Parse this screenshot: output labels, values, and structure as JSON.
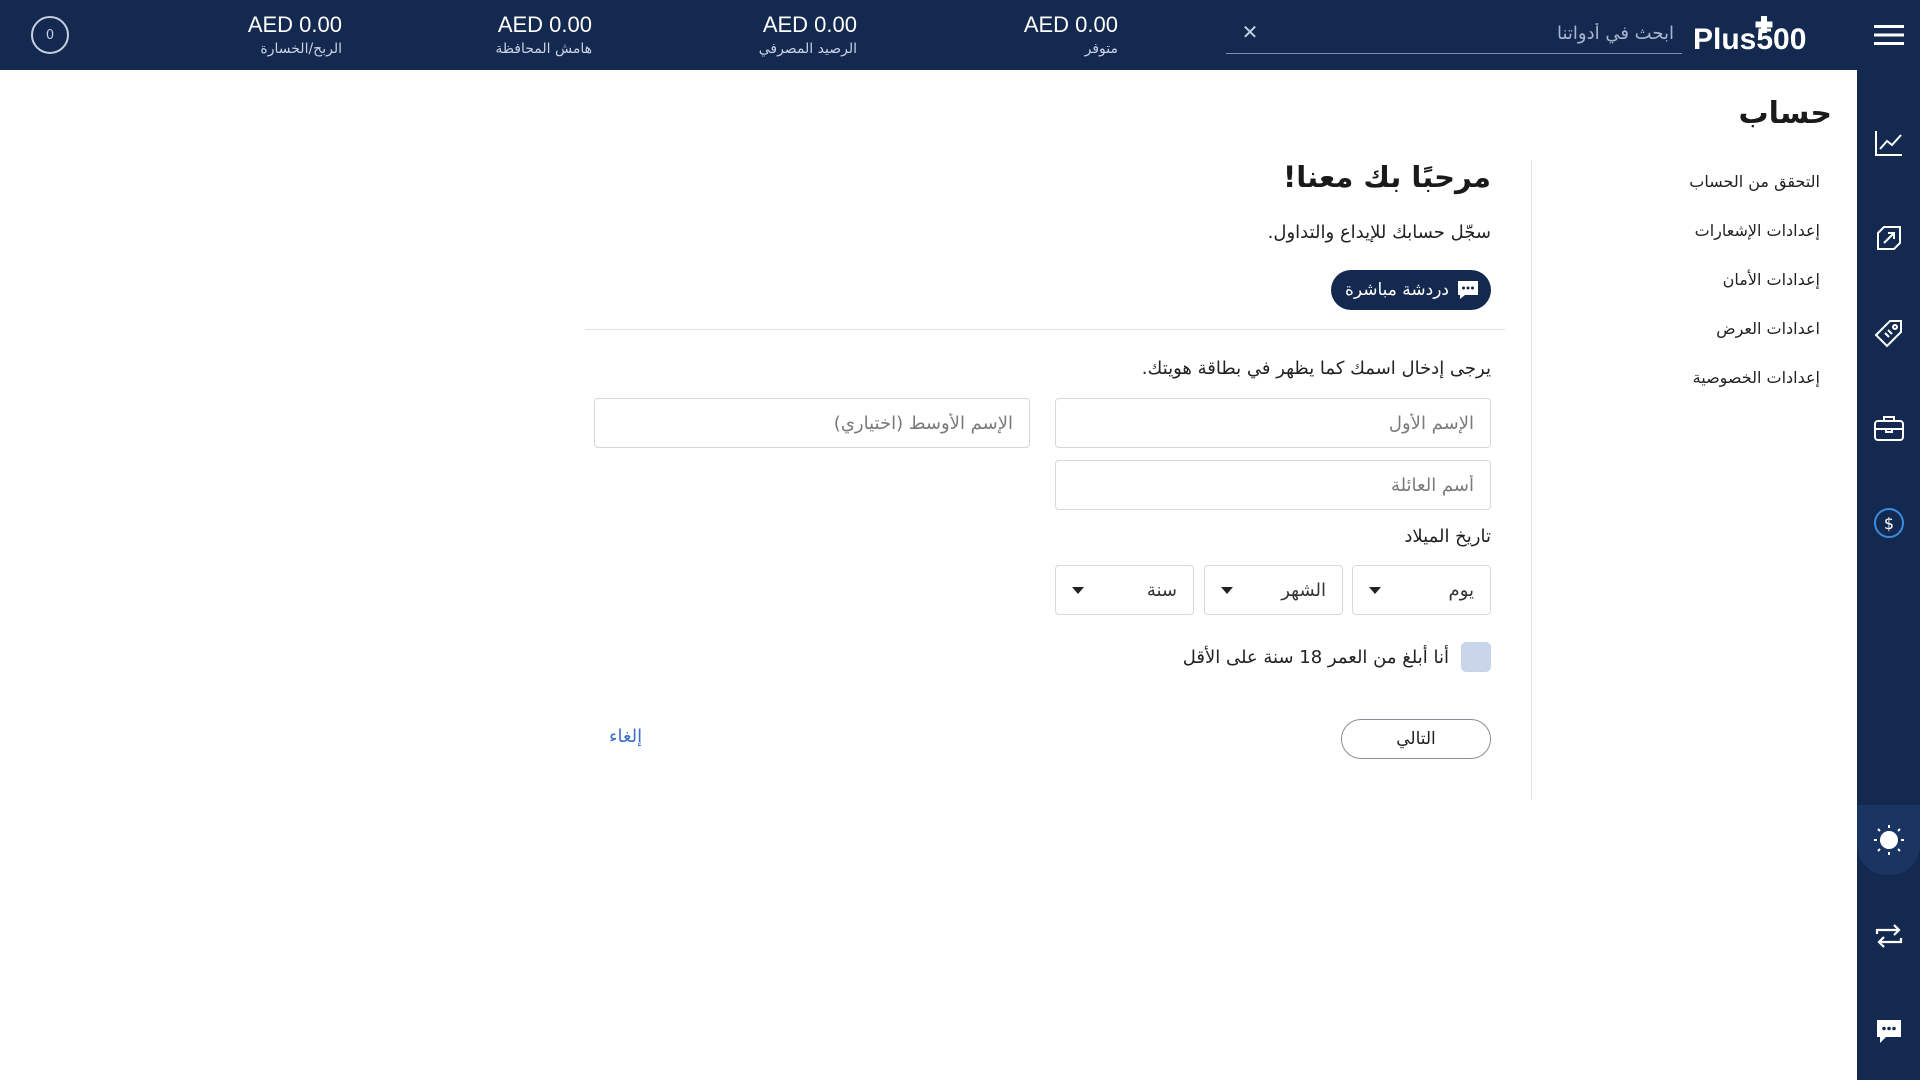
{
  "brand": {
    "name": "Plus500",
    "color": "#14294f",
    "accent": "#3b6fc6"
  },
  "search": {
    "placeholder": "ابحث في أدواتنا",
    "clear_icon": "close-icon"
  },
  "stats": [
    {
      "value": "AED 0.00",
      "label": "متوفر"
    },
    {
      "value": "AED 0.00",
      "label": "الرصيد المصرفي"
    },
    {
      "value": "AED 0.00",
      "label": "هامش المحافظة"
    },
    {
      "value": "AED 0.00",
      "label": "الربح/الخسارة"
    }
  ],
  "notifications": {
    "count": "0"
  },
  "page": {
    "title": "حساب"
  },
  "side_nav": {
    "items": [
      {
        "label": "التحقق من الحساب"
      },
      {
        "label": "إعدادات الإشعارات"
      },
      {
        "label": "إعدادات الأمان"
      },
      {
        "label": "اعدادات العرض"
      },
      {
        "label": "إعدادات الخصوصية"
      }
    ]
  },
  "form": {
    "welcome": "مرحبًا بك معنا!",
    "subtitle": "سجّل حسابك للإيداع والتداول.",
    "chat_label": "دردشة مباشرة",
    "instruction": "يرجى إدخال اسمك كما يظهر في بطاقة هويتك.",
    "first_name_placeholder": "الإسم الأول",
    "middle_name_placeholder": "الإسم الأوسط (اختياري)",
    "last_name_placeholder": "أسم العائلة",
    "dob_label": "تاريخ الميلاد",
    "day": "يوم",
    "month": "الشهر",
    "year": "سنة",
    "age_confirm": "أنا أبلغ من العمر 18 سنة على الأقل",
    "next_label": "التالي",
    "cancel_label": "إلغاء"
  },
  "right_bar_icons": [
    "menu-icon",
    "chart-icon",
    "trade-icon",
    "tag-icon",
    "briefcase-icon",
    "dollar-icon",
    "sun-icon",
    "swap-icon",
    "chat-icon"
  ]
}
